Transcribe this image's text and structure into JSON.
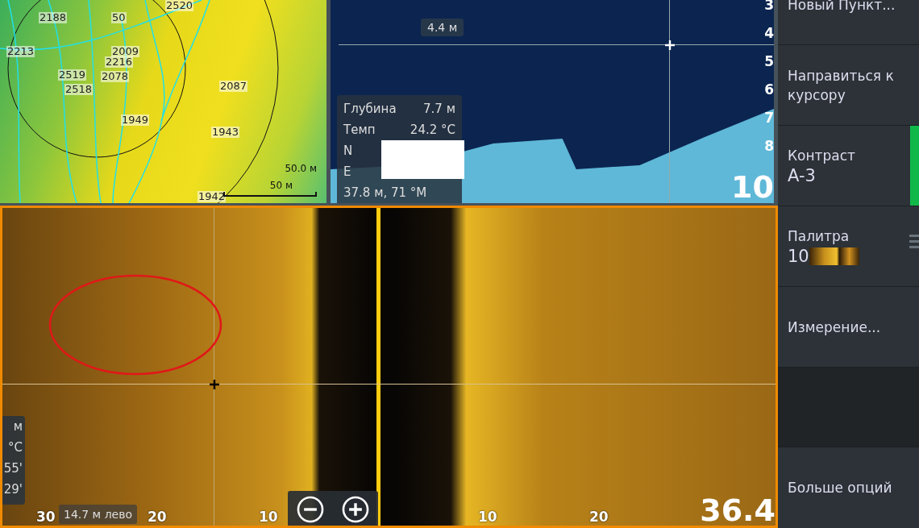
{
  "map": {
    "labels": [
      "2520",
      "2188",
      "50",
      "2213",
      "2009",
      "2216",
      "2519",
      "2078",
      "2518",
      "2087",
      "1949",
      "1943",
      "1942"
    ],
    "range_ring": "50.0 м",
    "scale": "50 м"
  },
  "sonar": {
    "depth_scale": [
      "3",
      "4",
      "5",
      "6",
      "7",
      "8"
    ],
    "range": "10",
    "cursor_depth": "4.4 м",
    "info": [
      {
        "label": "Глубина",
        "value": "7.7  м"
      },
      {
        "label": "Темп",
        "value": "24.2 °C"
      },
      {
        "label": "N"
      },
      {
        "label": "E"
      }
    ],
    "position": "37.8 м, 71 °M"
  },
  "sidescan": {
    "info_partial": [
      "м",
      "°C",
      "55'",
      "29'"
    ],
    "range_labels": [
      "30",
      "20",
      "10",
      "10",
      "20"
    ],
    "range": "36.4",
    "cursor_info": "14.7 м лево",
    "zoom_buttons": [
      {
        "kind": "minus"
      },
      {
        "kind": "plus"
      }
    ]
  },
  "menu": {
    "items": [
      {
        "kind": "action",
        "label": "Новый Пункт..."
      },
      {
        "kind": "action",
        "label": "Направиться к курсору"
      },
      {
        "kind": "slider",
        "label": "Контраст",
        "value": "A-3",
        "level": 1
      },
      {
        "kind": "palette",
        "label": "Палитра",
        "value": "10"
      },
      {
        "kind": "action",
        "label": "Измерение..."
      },
      {
        "kind": "spacer"
      },
      {
        "kind": "more",
        "label": "Больше опций"
      }
    ]
  }
}
